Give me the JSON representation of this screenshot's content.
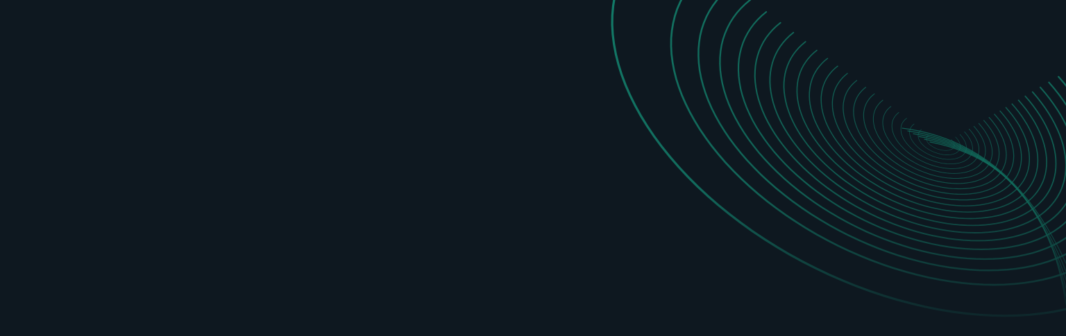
{
  "banner": {
    "background_color": "#0e1820",
    "accent_color": "#13806b",
    "decoration": "concentric-arc-tunnel"
  }
}
